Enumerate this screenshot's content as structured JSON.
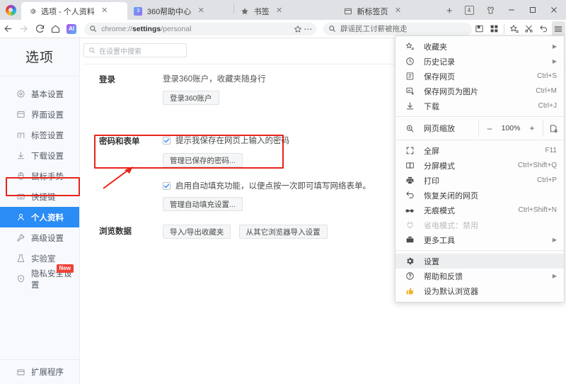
{
  "window": {
    "tab_count_badge": "4",
    "controls": {
      "skin": "shirt-icon",
      "minimize": "–",
      "maximize": "□",
      "close": "✕"
    }
  },
  "tabs": [
    {
      "title": "选项 - 个人资料",
      "favicon": "gear-icon",
      "active": true,
      "close": "✕"
    },
    {
      "title": "360帮助中心",
      "favicon": "360-icon",
      "active": false,
      "close": "✕"
    },
    {
      "title": "书签",
      "favicon": "star-icon",
      "active": false,
      "close": "✕"
    },
    {
      "title": "新标签页",
      "favicon": "newtab-icon",
      "active": false,
      "close": "✕"
    }
  ],
  "newtab_button": "+",
  "toolbar": {
    "back": "back-arrow-icon",
    "forward": "forward-arrow-icon",
    "reload": "reload-icon",
    "home": "home-icon",
    "ai_badge": "AI",
    "url_prefix": "chrome://",
    "url_bold": "settings",
    "url_suffix": "/personal",
    "bookmark_star": "star-icon",
    "more": "⋯",
    "search_value": "辟谣民工讨薪被拖走",
    "icons": [
      "reading-list-icon",
      "apps-grid-icon",
      "add-favorite-icon",
      "scissors-icon",
      "undo-icon",
      "hamburger-menu-icon"
    ]
  },
  "sidebar": {
    "title": "选项",
    "items": [
      {
        "label": "基本设置",
        "icon": "target-icon"
      },
      {
        "label": "界面设置",
        "icon": "window-icon"
      },
      {
        "label": "标签设置",
        "icon": "tab-icon"
      },
      {
        "label": "下载设置",
        "icon": "download-icon"
      },
      {
        "label": "鼠标手势",
        "icon": "mouse-icon"
      },
      {
        "label": "快捷键",
        "icon": "keyboard-icon"
      },
      {
        "label": "个人资料",
        "icon": "user-icon",
        "selected": true
      },
      {
        "label": "高级设置",
        "icon": "wrench-icon"
      },
      {
        "label": "实验室",
        "icon": "flask-icon"
      },
      {
        "label": "隐私安全设置",
        "icon": "shield-icon",
        "badge": "New"
      }
    ],
    "bottom_item": {
      "label": "扩展程序",
      "icon": "extension-icon"
    }
  },
  "settings": {
    "search_placeholder": "在设置中搜索",
    "sections": {
      "login": {
        "label": "登录",
        "description": "登录360账户，收藏夹随身行",
        "button": "登录360账户"
      },
      "password_forms": {
        "label": "密码和表单",
        "checkbox_password": "提示我保存在网页上输入的密码",
        "button_password": "管理已保存的密码...",
        "checkbox_autofill": "启用自动填充功能，以便点按一次即可填写网络表单。",
        "button_autofill": "管理自动填充设置..."
      },
      "browse_data": {
        "label": "浏览数据",
        "button_import_export": "导入/导出收藏夹",
        "button_import_other": "从其它浏览器导入设置"
      }
    }
  },
  "menu": {
    "items": [
      {
        "icon": "favorites-icon",
        "label": "收藏夹",
        "submenu": true
      },
      {
        "icon": "history-icon",
        "label": "历史记录",
        "submenu": true
      },
      {
        "icon": "save-page-icon",
        "label": "保存网页",
        "shortcut": "Ctrl+S"
      },
      {
        "icon": "save-image-icon",
        "label": "保存网页为图片",
        "shortcut": "Ctrl+M"
      },
      {
        "icon": "download-icon",
        "label": "下载",
        "shortcut": "Ctrl+J"
      }
    ],
    "zoom": {
      "icon": "zoom-icon",
      "label": "网页缩放",
      "minus": "–",
      "value": "100%",
      "plus": "+",
      "fullscreen_icon": "fit-page-icon"
    },
    "items2": [
      {
        "icon": "fullscreen-icon",
        "label": "全屏",
        "shortcut": "F11"
      },
      {
        "icon": "split-screen-icon",
        "label": "分屏模式",
        "shortcut": "Ctrl+Shift+Q"
      },
      {
        "icon": "printer-icon",
        "label": "打印",
        "shortcut": "Ctrl+P"
      },
      {
        "icon": "restore-tab-icon",
        "label": "恢复关闭的网页",
        "shortcut": ""
      },
      {
        "icon": "incognito-icon",
        "label": "无痕模式",
        "shortcut": "Ctrl+Shift+N"
      },
      {
        "icon": "battery-saver-icon",
        "label": "省电模式：禁用",
        "shortcut": "",
        "disabled": true
      },
      {
        "icon": "toolbox-icon",
        "label": "更多工具",
        "submenu": true
      }
    ],
    "items3": [
      {
        "icon": "gear-icon",
        "label": "设置",
        "highlight": true
      },
      {
        "icon": "help-icon",
        "label": "帮助和反馈",
        "submenu": true
      },
      {
        "icon": "thumbsup-icon",
        "label": "设为默认浏览器"
      }
    ]
  },
  "colors": {
    "accent": "#2a8cf5",
    "annotation": "#e8241a",
    "badge_new": "#ef4136",
    "tabstrip": "#dfe1e5"
  }
}
